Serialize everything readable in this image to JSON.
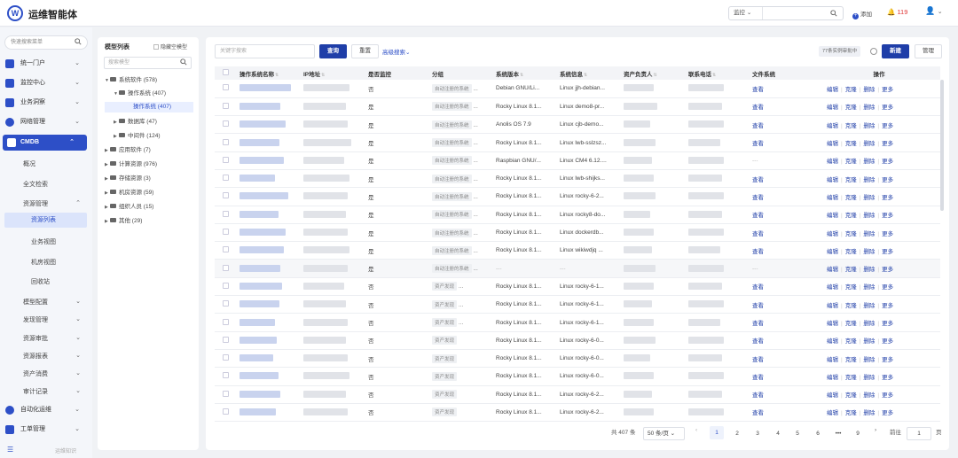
{
  "header": {
    "logo": "W",
    "app_title": "运维智能体",
    "search_select": "监控",
    "search_placeholder": "",
    "add_label": "添加",
    "alert_count": "119"
  },
  "sidebar": {
    "search_placeholder": "快速搜索菜单",
    "top_items": [
      {
        "label": "统一门户"
      },
      {
        "label": "监控中心"
      },
      {
        "label": "业务洞察"
      },
      {
        "label": "网络管理"
      }
    ],
    "cmdb": {
      "label": "CMDB"
    },
    "cmdb_subs": [
      {
        "label": "概况"
      },
      {
        "label": "全文检索"
      }
    ],
    "resource_mgmt": "资源管理",
    "resource_subs": [
      {
        "label": "资源列表"
      },
      {
        "label": "业务视图"
      },
      {
        "label": "机房视图"
      },
      {
        "label": "回收站"
      }
    ],
    "cmdb_more": [
      {
        "label": "模型配置"
      },
      {
        "label": "发现管理"
      },
      {
        "label": "资源审批"
      },
      {
        "label": "资源报表"
      },
      {
        "label": "资产消费"
      },
      {
        "label": "审计记录"
      }
    ],
    "bottom_items": [
      {
        "label": "自动化运维"
      },
      {
        "label": "工单管理"
      }
    ],
    "footer": "运维知识"
  },
  "tree": {
    "title": "模型列表",
    "hide_empty": "隐藏空模型",
    "search_placeholder": "搜索模型",
    "nodes": [
      {
        "label": "系统软件 (578)"
      },
      {
        "label": "操作系统 (407)"
      },
      {
        "label": "操作系统 (407)"
      },
      {
        "label": "数据库 (47)"
      },
      {
        "label": "中间件 (124)"
      },
      {
        "label": "应用软件 (7)"
      },
      {
        "label": "计算资源 (976)"
      },
      {
        "label": "存储资源 (3)"
      },
      {
        "label": "机房资源 (59)"
      },
      {
        "label": "组织人员 (15)"
      },
      {
        "label": "其他 (29)"
      }
    ]
  },
  "toolbar": {
    "keyword_placeholder": "关键字搜索",
    "query": "查询",
    "reset": "重置",
    "advanced": "高级搜索",
    "realtime_badge": "77条实例审批中",
    "new": "新建",
    "manage": "管理"
  },
  "table": {
    "columns": [
      "操作系统名称",
      "IP地址",
      "是否监控",
      "分组",
      "系统版本",
      "系统信息",
      "资产负责人",
      "联系电话",
      "文件系统",
      "操作"
    ],
    "view": "查看",
    "ops": [
      "编辑",
      "克隆",
      "删除",
      "更多"
    ],
    "rows": [
      {
        "monitor": "否",
        "group": "自动注册的系统",
        "version": "Debian GNU/Li...",
        "info": "Linux jjh-debian...",
        "fs": "查看"
      },
      {
        "monitor": "是",
        "group": "自动注册的系统",
        "version": "Rocky Linux 8.1...",
        "info": "Linux demo8-pr...",
        "fs": "查看"
      },
      {
        "monitor": "是",
        "group": "自动注册的系统",
        "version": "Anolis OS 7.9",
        "info": "Linux cjb-demo...",
        "fs": "查看"
      },
      {
        "monitor": "是",
        "group": "自动注册的系统",
        "version": "Rocky Linux 8.1...",
        "info": "Linux lwb-sslzsz...",
        "fs": "查看"
      },
      {
        "monitor": "是",
        "group": "自动注册的系统",
        "version": "Raspbian GNU/...",
        "info": "Linux CM4 6.12....",
        "fs": "---"
      },
      {
        "monitor": "是",
        "group": "自动注册的系统",
        "version": "Rocky Linux 8.1...",
        "info": "Linux lwb-shijks...",
        "fs": "查看"
      },
      {
        "monitor": "是",
        "group": "自动注册的系统",
        "version": "Rocky Linux 8.1...",
        "info": "Linux rocky-6-2...",
        "fs": "查看"
      },
      {
        "monitor": "是",
        "group": "自动注册的系统",
        "version": "Rocky Linux 8.1...",
        "info": "Linux rocky8-do...",
        "fs": "查看"
      },
      {
        "monitor": "是",
        "group": "自动注册的系统",
        "version": "Rocky Linux 8.1...",
        "info": "Linux dockerdb...",
        "fs": "查看"
      },
      {
        "monitor": "是",
        "group": "自动注册的系统",
        "version": "Rocky Linux 8.1...",
        "info": "Linux wikiwdjq ...",
        "fs": "查看"
      },
      {
        "monitor": "是",
        "group": "自动注册的系统",
        "version": "---",
        "info": "---",
        "fs": "---"
      },
      {
        "monitor": "否",
        "group": "资产发现",
        "version": "Rocky Linux 8.1...",
        "info": "Linux rocky-6-1...",
        "fs": "查看"
      },
      {
        "monitor": "否",
        "group": "资产发现",
        "version": "Rocky Linux 8.1...",
        "info": "Linux rocky-6-1...",
        "fs": "查看"
      },
      {
        "monitor": "否",
        "group": "资产发现",
        "version": "Rocky Linux 8.1...",
        "info": "Linux rocky-6-1...",
        "fs": "查看"
      },
      {
        "monitor": "否",
        "group": "资产发现",
        "version": "Rocky Linux 8.1...",
        "info": "Linux rocky-6-0...",
        "fs": "查看"
      },
      {
        "monitor": "否",
        "group": "资产发现",
        "version": "Rocky Linux 8.1...",
        "info": "Linux rocky-6-0...",
        "fs": "查看"
      },
      {
        "monitor": "否",
        "group": "资产发现",
        "version": "Rocky Linux 8.1...",
        "info": "Linux rocky-6-0...",
        "fs": "查看"
      },
      {
        "monitor": "否",
        "group": "资产发现",
        "version": "Rocky Linux 8.1...",
        "info": "Linux rocky-6-2...",
        "fs": "查看"
      },
      {
        "monitor": "否",
        "group": "资产发现",
        "version": "Rocky Linux 8.1...",
        "info": "Linux rocky-6-2...",
        "fs": "查看"
      }
    ]
  },
  "pagination": {
    "total": "共 407 条",
    "page_size": "50 条/页",
    "pages": [
      "1",
      "2",
      "3",
      "4",
      "5",
      "6",
      "•••",
      "9"
    ],
    "goto": "前往",
    "goto_value": "1",
    "page_unit": "页"
  }
}
